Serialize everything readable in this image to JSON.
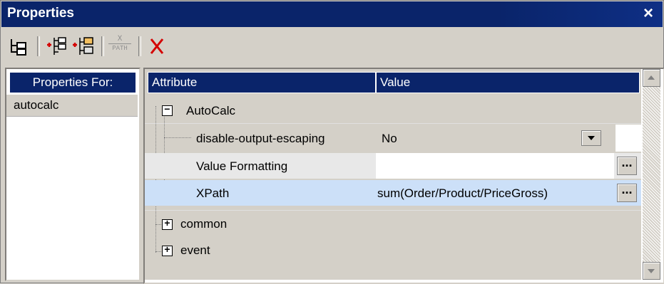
{
  "window": {
    "title": "Properties",
    "close_label": "×"
  },
  "toolbar": {
    "xpath_icon_top": "X",
    "xpath_icon_bottom": "PATH"
  },
  "left_pane": {
    "header": "Properties For:",
    "items": [
      "autocalc"
    ]
  },
  "grid": {
    "columns": [
      "Attribute",
      "Value"
    ],
    "group": {
      "expander": "⊟",
      "label": "AutoCalc"
    },
    "rows": [
      {
        "label": "disable-output-escaping",
        "value": "No"
      },
      {
        "label": "Value Formatting",
        "value": ""
      },
      {
        "label": "XPath",
        "value": "sum(Order/Product/PriceGross)"
      }
    ],
    "collapsed_groups": [
      {
        "expander": "⊞",
        "label": "common"
      },
      {
        "expander": "⊞",
        "label": "event"
      }
    ],
    "dots_label": "..."
  },
  "colors": {
    "title_bg": "#0a246a",
    "header_bg": "#0a246a",
    "selected_row_bg": "#cce0f8",
    "delete_red": "#d40000"
  }
}
